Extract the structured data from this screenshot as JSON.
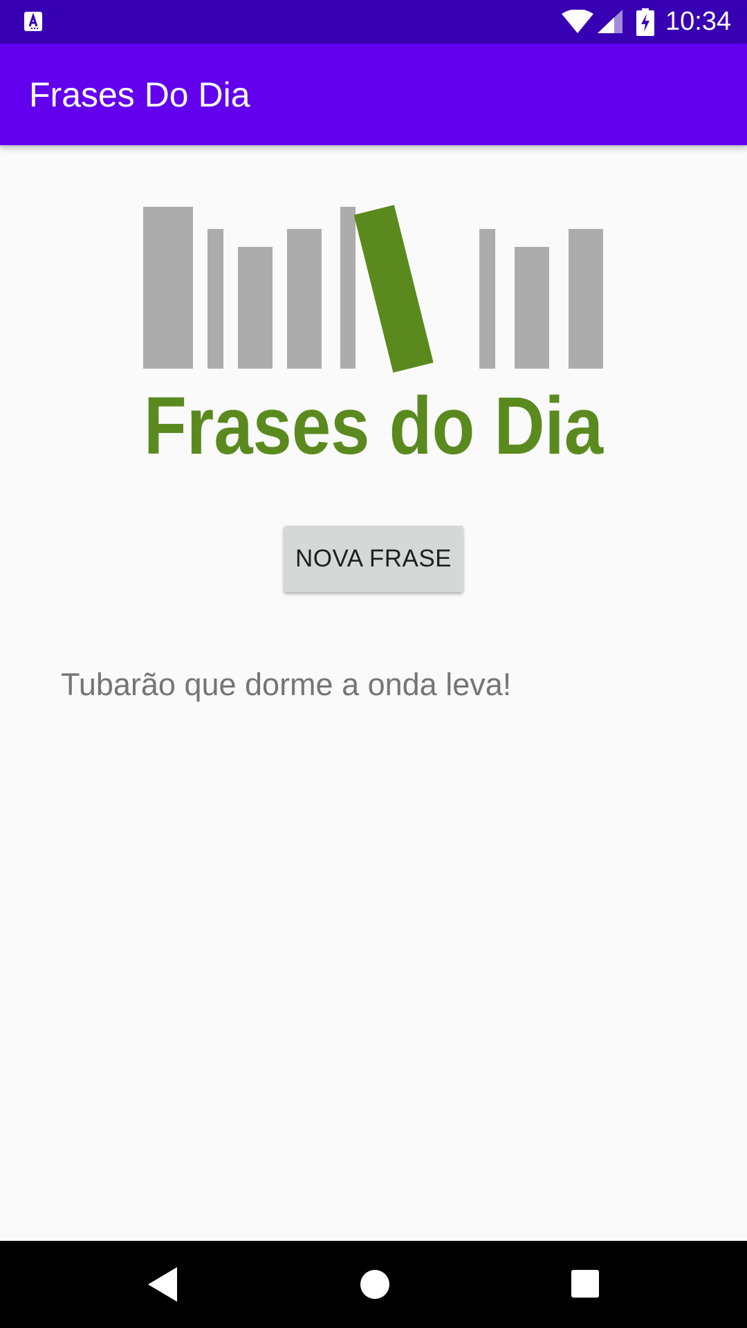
{
  "status_bar": {
    "time": "10:34",
    "icons": [
      "notification-a-icon",
      "wifi-icon",
      "signal-icon",
      "battery-charging-icon"
    ],
    "background": "#3700b3"
  },
  "app_bar": {
    "title": "Frases Do Dia",
    "background": "#6200ee"
  },
  "logo": {
    "text": "Frases do Dia",
    "text_color": "#5a8a1e",
    "bar_color": "#acacac",
    "accent_book_color": "#5a8a1e"
  },
  "main": {
    "button_label": "NOVA FRASE",
    "phrase": "Tubarão que dorme a onda leva!"
  },
  "nav_bar": {
    "icons": [
      "back-icon",
      "home-icon",
      "recents-icon"
    ]
  }
}
